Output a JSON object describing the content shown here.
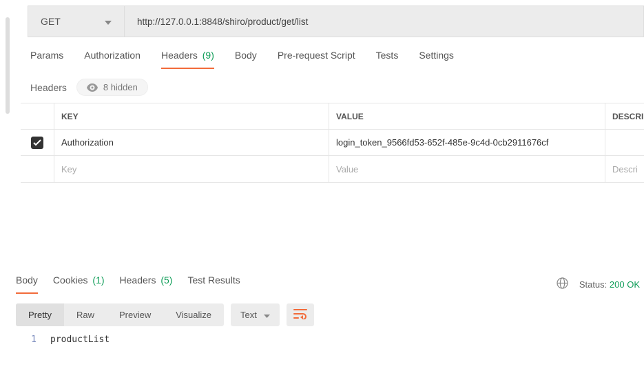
{
  "request": {
    "method": "GET",
    "url": "http://127.0.0.1:8848/shiro/product/get/list"
  },
  "requestTabs": {
    "params": "Params",
    "authorization": "Authorization",
    "headers": "Headers",
    "headers_count": "(9)",
    "body": "Body",
    "prerequest": "Pre-request Script",
    "tests": "Tests",
    "settings": "Settings"
  },
  "headersSection": {
    "title": "Headers",
    "hiddenLabel": "8 hidden",
    "columns": {
      "key": "KEY",
      "value": "VALUE",
      "desc": "DESCRI"
    },
    "rows": [
      {
        "checked": true,
        "key": "Authorization",
        "value": "login_token_9566fd53-652f-485e-9c4d-0cb2911676cf"
      }
    ],
    "placeholders": {
      "key": "Key",
      "value": "Value",
      "desc": "Descri"
    }
  },
  "responseTabs": {
    "body": "Body",
    "cookies": "Cookies",
    "cookies_count": "(1)",
    "headers": "Headers",
    "headers_count": "(5)",
    "testResults": "Test Results"
  },
  "responseMeta": {
    "statusLabel": "Status:",
    "statusValue": "200 OK"
  },
  "responseToolbar": {
    "pretty": "Pretty",
    "raw": "Raw",
    "preview": "Preview",
    "visualize": "Visualize",
    "format": "Text"
  },
  "responseBody": {
    "line1_num": "1",
    "line1_text": "productList"
  }
}
